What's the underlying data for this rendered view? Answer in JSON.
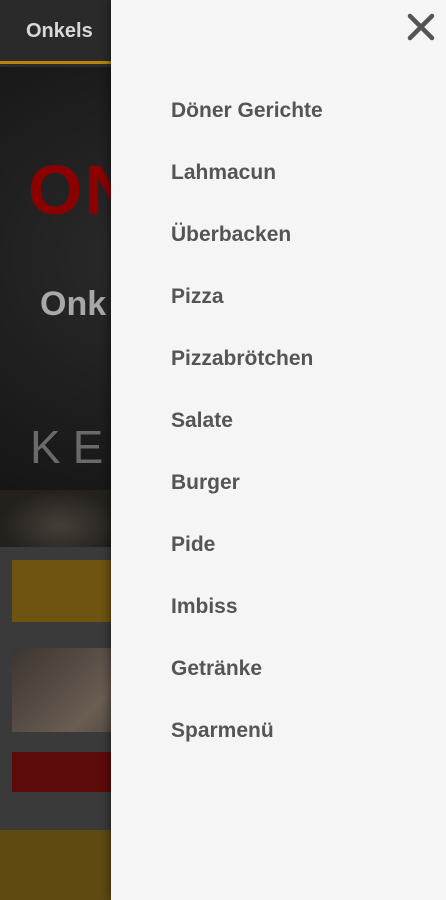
{
  "background": {
    "brand_title": "Onkels",
    "hero_logo_fragment": "ON",
    "hero_subtitle_fragment": "Onk",
    "hero_tagline_fragment": "KE",
    "accent_color": "#b8860b"
  },
  "drawer": {
    "close_icon": "close-icon",
    "items": [
      {
        "label": "Döner Gerichte"
      },
      {
        "label": "Lahmacun"
      },
      {
        "label": "Überbacken"
      },
      {
        "label": "Pizza"
      },
      {
        "label": "Pizzabrötchen"
      },
      {
        "label": "Salate"
      },
      {
        "label": "Burger"
      },
      {
        "label": "Pide"
      },
      {
        "label": "Imbiss"
      },
      {
        "label": "Getränke"
      },
      {
        "label": "Sparmenü"
      }
    ]
  }
}
